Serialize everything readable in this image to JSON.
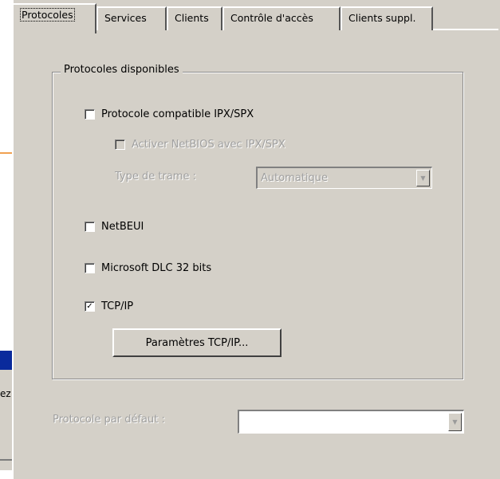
{
  "tabs": [
    {
      "label": "Protocoles",
      "active": true
    },
    {
      "label": "Services",
      "active": false
    },
    {
      "label": "Clients",
      "active": false
    },
    {
      "label": "Contrôle d'accès",
      "active": false
    },
    {
      "label": "Clients suppl.",
      "active": false
    }
  ],
  "group": {
    "title": "Protocoles disponibles"
  },
  "ipx": {
    "label": "Protocole compatible IPX/SPX",
    "checked": false
  },
  "netbios": {
    "label": "Activer NetBIOS avec IPX/SPX",
    "checked": false,
    "enabled": false
  },
  "frame_type": {
    "label": "Type de trame :",
    "value": "Automatique",
    "enabled": false
  },
  "netbeui": {
    "label": "NetBEUI",
    "checked": false
  },
  "dlc": {
    "label": "Microsoft DLC 32 bits",
    "checked": false
  },
  "tcpip": {
    "label": "TCP/IP",
    "checked": true,
    "check_glyph": "✓"
  },
  "tcpip_settings": {
    "label": "Paramètres TCP/IP..."
  },
  "default_protocol": {
    "label": "Protocole par défaut :",
    "value": "",
    "enabled": false
  },
  "background_window": {
    "fragment_text": "ez"
  },
  "colors": {
    "dialog_bg": "#d4d0c8",
    "titlebar_blue": "#0a2a9c",
    "accent_orange": "#f0a050"
  }
}
